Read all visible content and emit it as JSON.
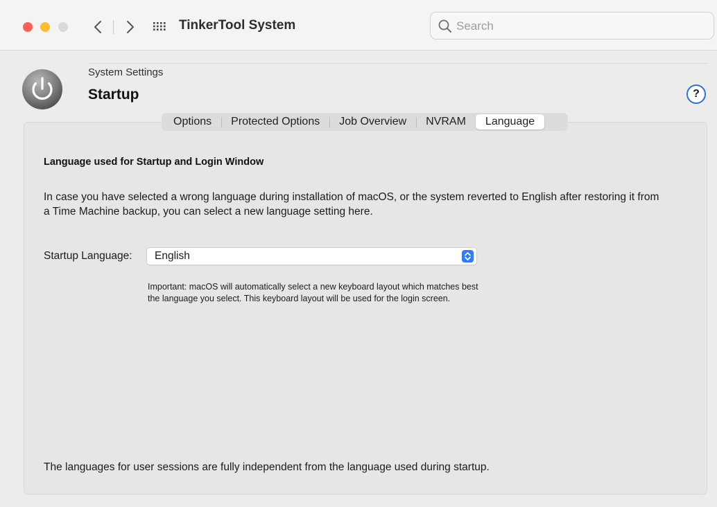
{
  "window": {
    "title": "TinkerTool System",
    "search_placeholder": "Search"
  },
  "header": {
    "breadcrumb": "System Settings",
    "title": "Startup",
    "help_label": "?"
  },
  "tabs": [
    {
      "label": "Options",
      "active": false
    },
    {
      "label": "Protected Options",
      "active": false
    },
    {
      "label": "Job Overview",
      "active": false
    },
    {
      "label": "NVRAM",
      "active": false
    },
    {
      "label": "Language",
      "active": true
    }
  ],
  "content": {
    "section_title": "Language used for Startup and Login Window",
    "description": "In case you have selected a wrong language during installation of macOS, or the system reverted to English after restoring it from a Time Machine backup, you can select a new language setting here.",
    "startup_language_label": "Startup Language:",
    "startup_language_value": "English",
    "note": "Important: macOS will automatically select a new keyboard layout which matches best the language you select. This keyboard layout will be used for the login screen.",
    "footer": "The languages for user sessions are fully independent from the language used during startup."
  },
  "colors": {
    "accent": "#2f7cf6",
    "close": "#fe5f57",
    "minimize": "#febc2e",
    "zoom_disabled": "#d9d9d9"
  },
  "icons": [
    "back-icon",
    "forward-icon",
    "app-grid-icon",
    "search-icon",
    "power-icon",
    "help-icon",
    "chevron-updown-icon"
  ]
}
